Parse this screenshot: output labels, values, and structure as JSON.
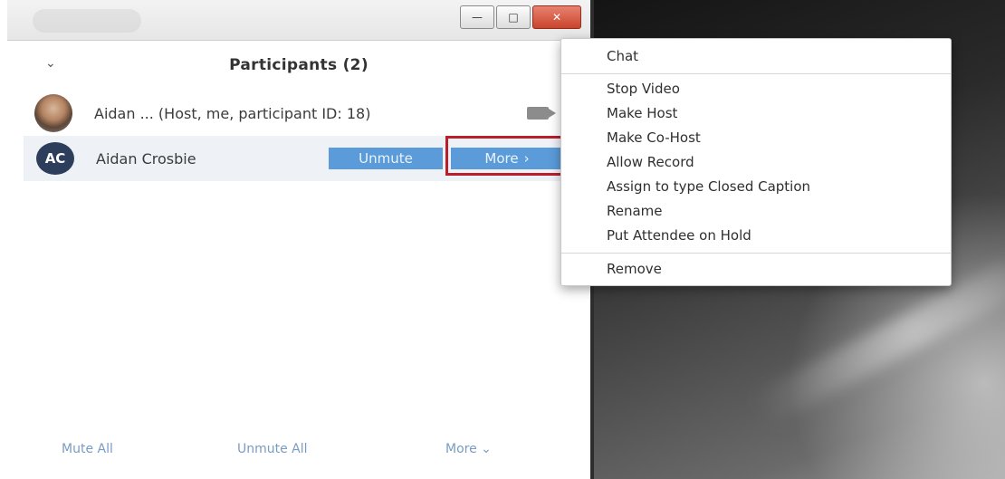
{
  "panel": {
    "title": "Participants (2)",
    "collapse_icon": "chevron-down-icon"
  },
  "participants": [
    {
      "name": "Aidan ...  (Host, me, participant ID: 18)",
      "avatar": "photo"
    },
    {
      "initials": "AC",
      "name": "Aidan Crosbie",
      "unmute_label": "Unmute",
      "more_label": "More",
      "more_icon": "chevron-right-icon"
    }
  ],
  "footer": {
    "mute_all": "Mute All",
    "unmute_all": "Unmute All",
    "more": "More",
    "more_icon": "chevron-down-icon"
  },
  "menu": {
    "items": [
      "Chat",
      "Stop Video",
      "Make Host",
      "Make Co-Host",
      "Allow Record",
      "Assign to type Closed Caption",
      "Rename",
      "Put Attendee on Hold",
      "Remove"
    ]
  },
  "colors": {
    "button_blue": "#5b9bd9",
    "highlight_red": "#b81f2a",
    "link_blue": "#7a9cc2",
    "avatar_navy": "#2c3e5c"
  }
}
